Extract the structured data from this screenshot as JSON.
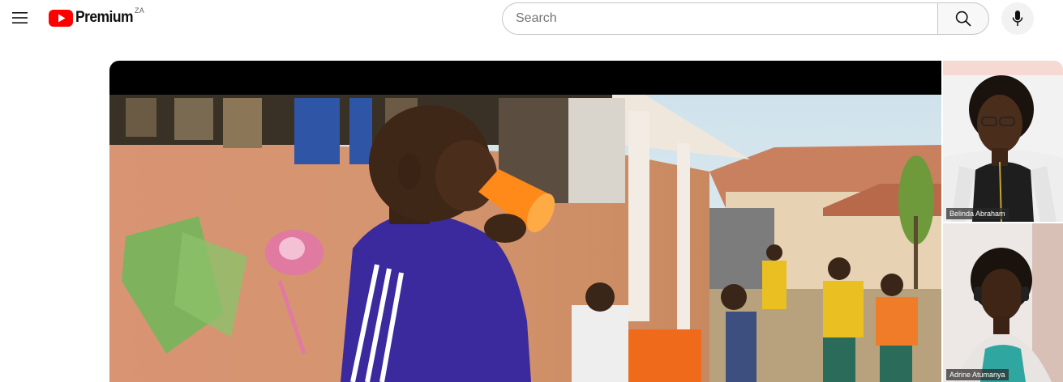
{
  "masthead": {
    "menu_icon": "hamburger-menu-icon",
    "logo": {
      "icon": "youtube-play-logo-icon",
      "brand_color": "#ff0000",
      "text": "Premium",
      "country_code": "ZA"
    },
    "search": {
      "placeholder": "Search",
      "value": "",
      "button_icon": "search-icon"
    },
    "voice_search_icon": "microphone-icon"
  },
  "player": {
    "participants": [
      {
        "name": "Belinda Abraham"
      },
      {
        "name": "Adrine Atumanya"
      }
    ]
  }
}
